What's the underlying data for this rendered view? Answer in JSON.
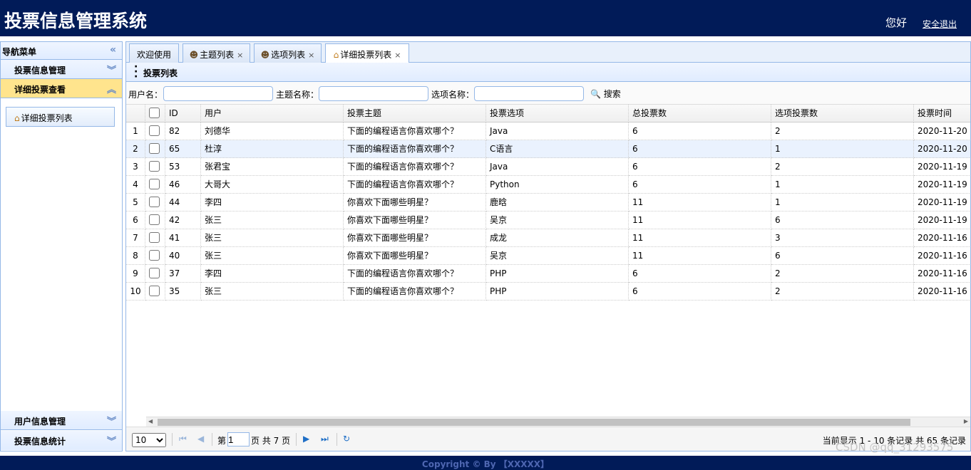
{
  "header": {
    "title": "投票信息管理系统",
    "greeting": "您好",
    "logout": "安全退出"
  },
  "sidebar": {
    "title": "导航菜单",
    "sections": [
      {
        "label": "投票信息管理"
      },
      {
        "label": "详细投票查看"
      },
      {
        "label": "用户信息管理"
      },
      {
        "label": "投票信息统计"
      }
    ],
    "link": "详细投票列表"
  },
  "tabs": [
    {
      "label": "欢迎使用"
    },
    {
      "label": "主题列表"
    },
    {
      "label": "选项列表"
    },
    {
      "label": "详细投票列表"
    }
  ],
  "panel": {
    "title": "投票列表"
  },
  "search": {
    "user_label": "用户名：",
    "subject_label": "主题名称：",
    "option_label": "选项名称：",
    "button": "搜索"
  },
  "table": {
    "columns": [
      "ID",
      "用户",
      "投票主题",
      "投票选项",
      "总投票数",
      "选项投票数",
      "投票时间"
    ],
    "rows": [
      {
        "n": "1",
        "id": "82",
        "user": "刘德华",
        "subject": "下面的编程语言你喜欢哪个？",
        "option": "Java",
        "total": "6",
        "count": "2",
        "time": "2020-11-20"
      },
      {
        "n": "2",
        "id": "65",
        "user": "杜淳",
        "subject": "下面的编程语言你喜欢哪个？",
        "option": "C语言",
        "total": "6",
        "count": "1",
        "time": "2020-11-20"
      },
      {
        "n": "3",
        "id": "53",
        "user": "张君宝",
        "subject": "下面的编程语言你喜欢哪个？",
        "option": "Java",
        "total": "6",
        "count": "2",
        "time": "2020-11-19"
      },
      {
        "n": "4",
        "id": "46",
        "user": "大哥大",
        "subject": "下面的编程语言你喜欢哪个？",
        "option": "Python",
        "total": "6",
        "count": "1",
        "time": "2020-11-19"
      },
      {
        "n": "5",
        "id": "44",
        "user": "李四",
        "subject": "你喜欢下面哪些明星？",
        "option": "鹿晗",
        "total": "11",
        "count": "1",
        "time": "2020-11-19"
      },
      {
        "n": "6",
        "id": "42",
        "user": "张三",
        "subject": "你喜欢下面哪些明星？",
        "option": "吴京",
        "total": "11",
        "count": "6",
        "time": "2020-11-19"
      },
      {
        "n": "7",
        "id": "41",
        "user": "张三",
        "subject": "你喜欢下面哪些明星？",
        "option": "成龙",
        "total": "11",
        "count": "3",
        "time": "2020-11-16"
      },
      {
        "n": "8",
        "id": "40",
        "user": "张三",
        "subject": "你喜欢下面哪些明星？",
        "option": "吴京",
        "total": "11",
        "count": "6",
        "time": "2020-11-16"
      },
      {
        "n": "9",
        "id": "37",
        "user": "李四",
        "subject": "下面的编程语言你喜欢哪个？",
        "option": "PHP",
        "total": "6",
        "count": "2",
        "time": "2020-11-16"
      },
      {
        "n": "10",
        "id": "35",
        "user": "张三",
        "subject": "下面的编程语言你喜欢哪个？",
        "option": "PHP",
        "total": "6",
        "count": "2",
        "time": "2020-11-16"
      }
    ]
  },
  "pager": {
    "page_size": "10",
    "page_prefix": "第",
    "page_value": "1",
    "page_suffix": "页 共 7 页",
    "info": "当前显示 1 - 10 条记录 共 65 条记录"
  },
  "footer": "Copyright © By 【XXXXX】",
  "watermark": "CSDN @qq_31293575",
  "colors": {
    "header_bg": "#011b58",
    "border": "#95b8e7",
    "active_accordion": "#ffe48d",
    "row_alt": "#eaf2fe"
  }
}
